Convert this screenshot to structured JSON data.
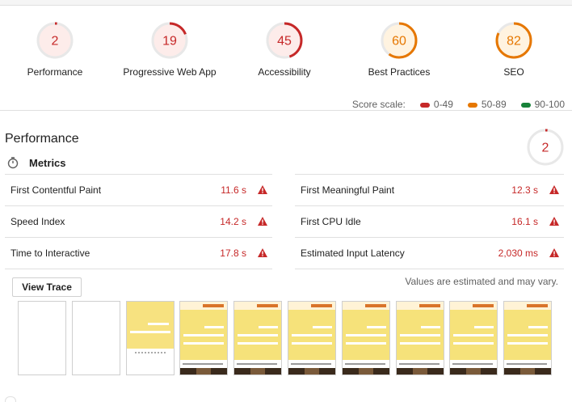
{
  "gauges": [
    {
      "score": "2",
      "label": "Performance",
      "fraction": 0.02,
      "color": "#c62828"
    },
    {
      "score": "19",
      "label": "Progressive Web App",
      "fraction": 0.19,
      "color": "#c62828"
    },
    {
      "score": "45",
      "label": "Accessibility",
      "fraction": 0.45,
      "color": "#c62828"
    },
    {
      "score": "60",
      "label": "Best Practices",
      "fraction": 0.6,
      "color": "#e67700"
    },
    {
      "score": "82",
      "label": "SEO",
      "fraction": 0.82,
      "color": "#e67700"
    }
  ],
  "score_scale": {
    "label": "Score scale:",
    "ranges": [
      {
        "text": "0-49",
        "color": "#c62828"
      },
      {
        "text": "50-89",
        "color": "#e67700"
      },
      {
        "text": "90-100",
        "color": "#178239"
      }
    ]
  },
  "category": {
    "title": "Performance",
    "score": "2",
    "fraction": 0.02,
    "color": "#c62828"
  },
  "metrics": {
    "header": "Metrics",
    "items": [
      {
        "name": "First Contentful Paint",
        "value": "11.6 s"
      },
      {
        "name": "First Meaningful Paint",
        "value": "12.3 s"
      },
      {
        "name": "Speed Index",
        "value": "14.2 s"
      },
      {
        "name": "First CPU Idle",
        "value": "16.1 s"
      },
      {
        "name": "Time to Interactive",
        "value": "17.8 s"
      },
      {
        "name": "Estimated Input Latency",
        "value": "2,030 ms"
      }
    ]
  },
  "view_trace_label": "View Trace",
  "estimate_note": "Values are estimated and may vary.",
  "filmstrip_frames": 10
}
